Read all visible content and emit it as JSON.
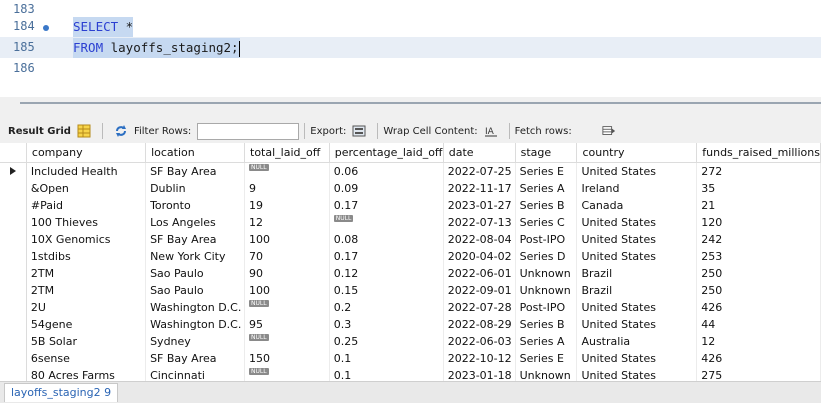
{
  "editor": {
    "lines": [
      {
        "number": "183",
        "code": ""
      },
      {
        "number": "184",
        "code": "SELECT *"
      },
      {
        "number": "185",
        "code": "FROM layoffs_staging2;"
      },
      {
        "number": "186",
        "code": ""
      }
    ],
    "keyword_select": "SELECT",
    "select_rest": " *",
    "keyword_from": "FROM",
    "from_rest": " layoffs_staging2;"
  },
  "toolbar": {
    "result_grid": "Result Grid",
    "filter_rows": "Filter Rows:",
    "filter_value": "",
    "export": "Export:",
    "wrap_cell": "Wrap Cell Content:",
    "fetch_rows": "Fetch rows:"
  },
  "grid": {
    "columns": [
      "company",
      "location",
      "total_laid_off",
      "percentage_laid_off",
      "date",
      "stage",
      "country",
      "funds_raised_millions"
    ],
    "rows": [
      [
        "Included Health",
        "SF Bay Area",
        "NULL",
        "0.06",
        "2022-07-25",
        "Series E",
        "United States",
        "272"
      ],
      [
        "&Open",
        "Dublin",
        "9",
        "0.09",
        "2022-11-17",
        "Series A",
        "Ireland",
        "35"
      ],
      [
        "#Paid",
        "Toronto",
        "19",
        "0.17",
        "2023-01-27",
        "Series B",
        "Canada",
        "21"
      ],
      [
        "100 Thieves",
        "Los Angeles",
        "12",
        "NULL",
        "2022-07-13",
        "Series C",
        "United States",
        "120"
      ],
      [
        "10X Genomics",
        "SF Bay Area",
        "100",
        "0.08",
        "2022-08-04",
        "Post-IPO",
        "United States",
        "242"
      ],
      [
        "1stdibs",
        "New York City",
        "70",
        "0.17",
        "2020-04-02",
        "Series D",
        "United States",
        "253"
      ],
      [
        "2TM",
        "Sao Paulo",
        "90",
        "0.12",
        "2022-06-01",
        "Unknown",
        "Brazil",
        "250"
      ],
      [
        "2TM",
        "Sao Paulo",
        "100",
        "0.15",
        "2022-09-01",
        "Unknown",
        "Brazil",
        "250"
      ],
      [
        "2U",
        "Washington D.C.",
        "NULL",
        "0.2",
        "2022-07-28",
        "Post-IPO",
        "United States",
        "426"
      ],
      [
        "54gene",
        "Washington D.C.",
        "95",
        "0.3",
        "2022-08-29",
        "Series B",
        "United States",
        "44"
      ],
      [
        "5B Solar",
        "Sydney",
        "NULL",
        "0.25",
        "2022-06-03",
        "Series A",
        "Australia",
        "12"
      ],
      [
        "6sense",
        "SF Bay Area",
        "150",
        "0.1",
        "2022-10-12",
        "Series E",
        "United States",
        "426"
      ],
      [
        "80 Acres Farms",
        "Cincinnati",
        "NULL",
        "0.1",
        "2023-01-18",
        "Unknown",
        "United States",
        "275"
      ]
    ]
  },
  "bottom_tab": {
    "label": "layoffs_staging2 9"
  },
  "colors": {
    "keyword": "#2b3fd1",
    "selection": "#c6d9f1",
    "tab_text": "#2a64b4",
    "null_badge": "#8a8a8a"
  }
}
